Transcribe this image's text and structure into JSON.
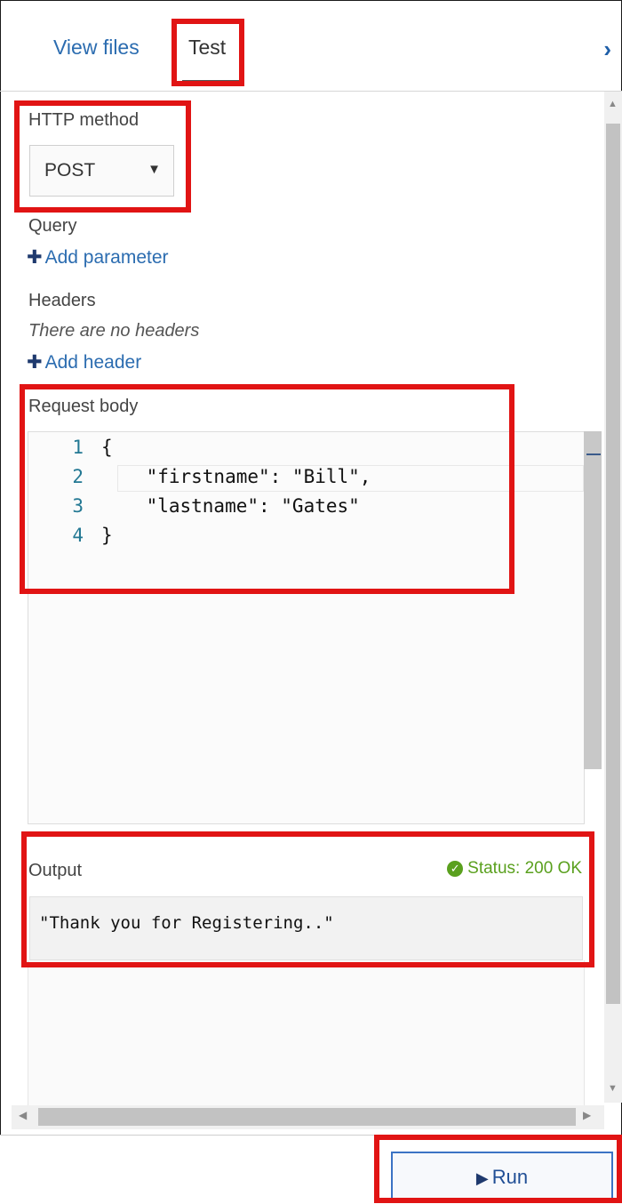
{
  "tabs": {
    "view_files": "View files",
    "test": "Test"
  },
  "http_method": {
    "label": "HTTP method",
    "value": "POST"
  },
  "query": {
    "label": "Query",
    "add_label": "Add parameter"
  },
  "headers": {
    "label": "Headers",
    "empty_text": "There are no headers",
    "add_label": "Add header"
  },
  "request_body": {
    "label": "Request body",
    "lines": [
      {
        "num": "1",
        "code": "{"
      },
      {
        "num": "2",
        "code": "    \"firstname\": \"Bill\","
      },
      {
        "num": "3",
        "code": "    \"lastname\": \"Gates\""
      },
      {
        "num": "4",
        "code": "}"
      }
    ]
  },
  "output": {
    "label": "Output",
    "status": "Status: 200 OK",
    "value": "\"Thank you for Registering..\""
  },
  "footer": {
    "run_label": "Run"
  },
  "colors": {
    "highlight": "#e11414",
    "link": "#2b6cb0",
    "status_ok": "#5aa01e"
  },
  "icons": {
    "collapse": "chevron-right-icon",
    "dropdown": "caret-down-icon",
    "add": "plus-icon",
    "status": "check-circle-icon",
    "run": "play-icon"
  }
}
